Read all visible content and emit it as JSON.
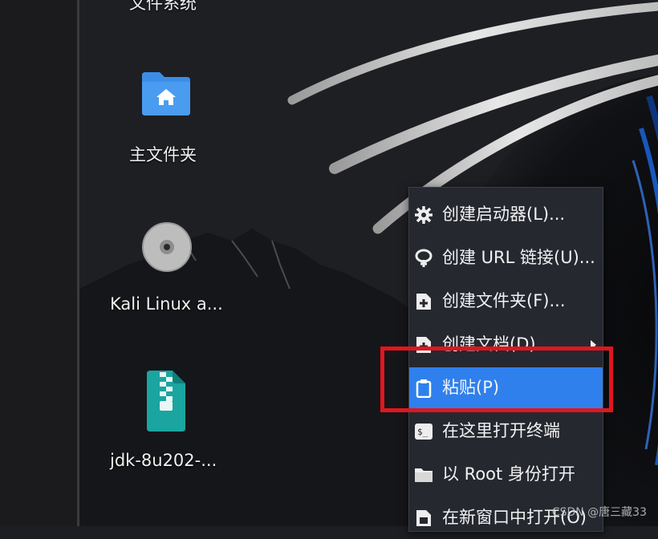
{
  "desktop": {
    "icons": [
      {
        "label": "文件系统",
        "icon": "filesystem-icon"
      },
      {
        "label": "主文件夹",
        "icon": "home-folder-icon"
      },
      {
        "label": "Kali Linux a...",
        "icon": "disc-icon"
      },
      {
        "label": "jdk-8u202-...",
        "icon": "archive-icon"
      }
    ]
  },
  "context_menu": {
    "items": [
      {
        "label": "创建启动器(L)...",
        "icon": "gear-icon"
      },
      {
        "label": "创建 URL 链接(U)...",
        "icon": "link-icon"
      },
      {
        "label": "创建文件夹(F)...",
        "icon": "new-folder-icon"
      },
      {
        "label": "创建文档(D)",
        "icon": "new-document-icon",
        "has_submenu": true
      },
      {
        "label": "粘贴(P)",
        "icon": "clipboard-icon",
        "highlighted": true
      },
      {
        "label": "在这里打开终端",
        "icon": "terminal-icon"
      },
      {
        "label": "以 Root 身份打开",
        "icon": "folder-icon"
      },
      {
        "label": "在新窗口中打开(O)",
        "icon": "new-window-icon"
      }
    ]
  },
  "watermark": "CSDN @唐三藏33",
  "colors": {
    "menu_background": "#262830",
    "highlight": "#2f80ed",
    "annotation_box": "#e0161f",
    "folder_blue": "#3b8ee8",
    "archive_teal": "#1aa5a0"
  }
}
